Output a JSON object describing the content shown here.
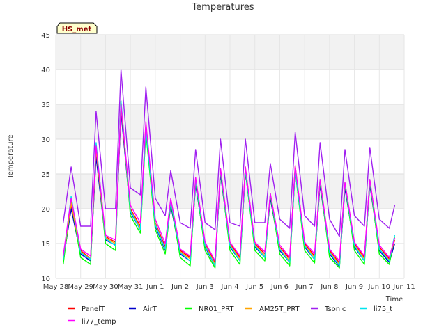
{
  "chart_data": {
    "type": "line",
    "title": "Temperatures",
    "xlabel": "Time",
    "ylabel": "Temperature",
    "badge": "HS_met",
    "xlim": [
      0,
      14
    ],
    "ylim": [
      10,
      45
    ],
    "yticks": [
      10,
      15,
      20,
      25,
      30,
      35,
      40,
      45
    ],
    "xticks": [
      "May 28",
      "May 29",
      "May 30",
      "May 31",
      "Jun 1",
      "Jun 2",
      "Jun 3",
      "Jun 4",
      "Jun 5",
      "Jun 6",
      "Jun 7",
      "Jun 8",
      "Jun 9",
      "Jun 10",
      "Jun 11"
    ],
    "grid": true,
    "shaded_bands": [
      [
        20,
        25
      ],
      [
        30,
        35
      ],
      [
        40,
        45
      ]
    ],
    "x_days_since_start": [
      0.3,
      0.62,
      1.0,
      1.4,
      1.62,
      2.0,
      2.4,
      2.62,
      3.0,
      3.4,
      3.62,
      4.0,
      4.4,
      4.62,
      5.0,
      5.4,
      5.62,
      6.0,
      6.4,
      6.62,
      7.0,
      7.4,
      7.62,
      8.0,
      8.4,
      8.62,
      9.0,
      9.4,
      9.62,
      10.0,
      10.4,
      10.62,
      11.0,
      11.4,
      11.62,
      12.0,
      12.4,
      12.62,
      13.0,
      13.4,
      13.62
    ],
    "series": [
      {
        "name": "PanelT",
        "color": "#ff0000",
        "values": [
          13.0,
          20.5,
          14.0,
          12.8,
          28.0,
          16.0,
          15.2,
          34.5,
          20.0,
          17.5,
          32.0,
          18.0,
          14.5,
          21.0,
          14.0,
          13.0,
          24.0,
          15.0,
          12.3,
          25.5,
          15.0,
          13.0,
          25.8,
          15.0,
          13.5,
          22.0,
          14.5,
          12.8,
          26.0,
          15.0,
          13.2,
          24.0,
          14.0,
          12.2,
          23.5,
          15.0,
          13.0,
          24.0,
          14.5,
          12.8,
          15.5
        ]
      },
      {
        "name": "AirT",
        "color": "#0000cc",
        "values": [
          12.5,
          20.0,
          13.5,
          12.5,
          27.5,
          15.5,
          14.8,
          34.0,
          19.5,
          17.0,
          31.5,
          17.5,
          14.0,
          20.5,
          13.5,
          12.5,
          23.5,
          14.5,
          11.8,
          25.0,
          14.5,
          12.5,
          25.3,
          14.5,
          13.0,
          21.5,
          14.0,
          12.3,
          25.5,
          14.5,
          12.7,
          23.5,
          13.5,
          11.7,
          23.0,
          14.5,
          12.5,
          23.5,
          14.0,
          12.3,
          15.0
        ]
      },
      {
        "name": "NR01_PRT",
        "color": "#00ff00",
        "values": [
          12.0,
          21.0,
          13.0,
          12.0,
          29.0,
          15.0,
          14.0,
          35.5,
          19.0,
          16.5,
          31.0,
          17.0,
          13.5,
          21.0,
          13.0,
          11.8,
          24.0,
          14.0,
          11.5,
          25.5,
          14.0,
          12.0,
          25.5,
          14.0,
          12.5,
          22.0,
          13.5,
          11.8,
          25.5,
          14.0,
          12.2,
          24.0,
          13.0,
          11.5,
          23.5,
          14.0,
          12.0,
          24.0,
          13.5,
          12.0,
          16.0
        ]
      },
      {
        "name": "AM25T_PRT",
        "color": "#ffa500",
        "values": [
          12.8,
          20.8,
          13.8,
          12.8,
          28.5,
          15.8,
          15.0,
          34.8,
          19.8,
          17.2,
          32.2,
          17.8,
          14.2,
          21.2,
          13.8,
          12.8,
          24.2,
          14.8,
          12.0,
          25.7,
          14.8,
          12.8,
          26.0,
          14.8,
          13.2,
          22.2,
          14.2,
          12.5,
          26.2,
          14.8,
          13.0,
          24.2,
          13.8,
          12.0,
          23.7,
          14.8,
          12.8,
          24.2,
          14.2,
          12.6,
          15.8
        ]
      },
      {
        "name": "Tsonic",
        "color": "#a020f0",
        "values": [
          18.0,
          26.0,
          17.5,
          17.5,
          34.0,
          20.0,
          20.0,
          40.0,
          23.0,
          22.0,
          37.5,
          21.5,
          19.0,
          25.5,
          18.0,
          17.2,
          28.5,
          18.0,
          17.0,
          30.0,
          18.0,
          17.5,
          30.0,
          18.0,
          18.0,
          26.5,
          18.5,
          17.2,
          31.0,
          19.0,
          17.5,
          29.5,
          18.5,
          16.0,
          28.5,
          19.0,
          17.5,
          28.8,
          18.5,
          17.2,
          20.5
        ]
      },
      {
        "name": "li75_t",
        "color": "#00e5ee",
        "values": [
          12.7,
          21.8,
          13.7,
          12.7,
          29.5,
          15.7,
          14.7,
          35.5,
          19.7,
          17.0,
          31.7,
          17.7,
          14.2,
          21.2,
          13.7,
          12.5,
          24.2,
          14.7,
          11.8,
          25.7,
          14.7,
          12.5,
          25.7,
          14.7,
          13.0,
          22.2,
          14.2,
          12.3,
          25.7,
          14.7,
          12.7,
          24.2,
          13.7,
          11.8,
          23.7,
          14.7,
          12.5,
          24.2,
          14.2,
          12.5,
          16.2
        ]
      },
      {
        "name": "li77_temp",
        "color": "#ff00ff",
        "values": [
          13.2,
          21.5,
          14.2,
          13.2,
          29.0,
          16.2,
          15.5,
          35.0,
          20.5,
          18.0,
          32.5,
          18.5,
          15.0,
          21.5,
          14.2,
          13.2,
          24.5,
          15.2,
          12.5,
          25.8,
          15.2,
          13.2,
          26.0,
          15.2,
          13.8,
          22.2,
          14.8,
          13.0,
          26.2,
          15.2,
          13.5,
          24.2,
          14.2,
          12.5,
          23.8,
          15.2,
          13.2,
          24.2,
          14.8,
          13.0,
          15.8
        ]
      }
    ],
    "legend_placement": "bottom"
  }
}
